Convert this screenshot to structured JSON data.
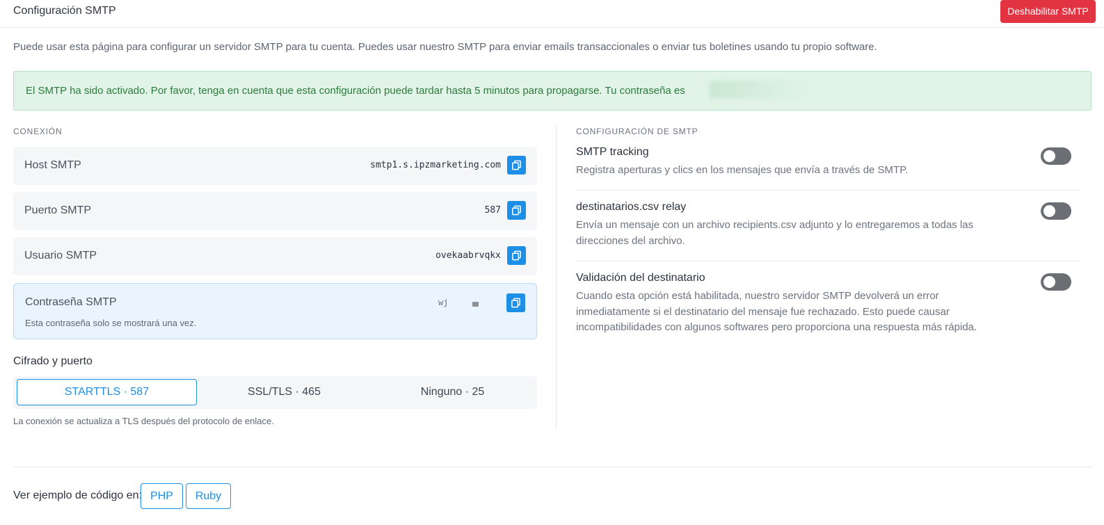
{
  "header": {
    "title": "Configuración SMTP",
    "disable_label": "Deshabilitar SMTP"
  },
  "intro": "Puede usar esta página para configurar un servidor SMTP para tu cuenta. Puedes usar nuestro SMTP para enviar emails transaccionales o enviar tus boletines usando tu propio software.",
  "alert": {
    "text": "El SMTP ha sido activado. Por favor, tenga en cuenta que esta configuración puede tardar hasta 5 minutos para propagarse. Tu contraseña es"
  },
  "connection": {
    "section_label": "CONEXIÓN",
    "host": {
      "label": "Host SMTP",
      "value": "smtp1.s.ipzmarketing.com"
    },
    "port": {
      "label": "Puerto SMTP",
      "value": "587"
    },
    "user": {
      "label": "Usuario SMTP",
      "value": "ovekaabrvqkx"
    },
    "password": {
      "label": "Contraseña SMTP",
      "value": "wj",
      "note": "Esta contraseña solo se mostrará una vez."
    }
  },
  "cipher": {
    "title": "Cifrado y puerto",
    "options": [
      "STARTTLS · 587",
      "SSL/TLS · 465",
      "Ninguno · 25"
    ],
    "selected": "STARTTLS · 587",
    "note": "La conexión se actualiza a TLS después del protocolo de enlace."
  },
  "smtp_settings": {
    "section_label": "CONFIGURACIÓN DE SMTP",
    "items": [
      {
        "title": "SMTP tracking",
        "description": "Registra aperturas y clics en los mensajes que envía a través de SMTP.",
        "enabled": false
      },
      {
        "title": "destinatarios.csv relay",
        "description": "Envía un mensaje con un archivo recipients.csv adjunto y lo entregaremos a todas las direcciones del archivo.",
        "enabled": false
      },
      {
        "title": "Validación del destinatario",
        "description": "Cuando esta opción está habilitada, nuestro servidor SMTP devolverá un error inmediatamente si el destinatario del mensaje fue rechazado. Esto puede causar incompatibilidades con algunos softwares pero proporciona una respuesta más rápida.",
        "enabled": false
      }
    ]
  },
  "code_example": {
    "label": "Ver ejemplo de código en:",
    "languages": [
      "PHP",
      "Ruby"
    ]
  },
  "colors": {
    "accent": "#1d8fe6",
    "danger": "#e23342",
    "success_bg": "#e1f4e7",
    "success_text": "#2c7a3d",
    "toggle_off": "#6b6e73"
  }
}
